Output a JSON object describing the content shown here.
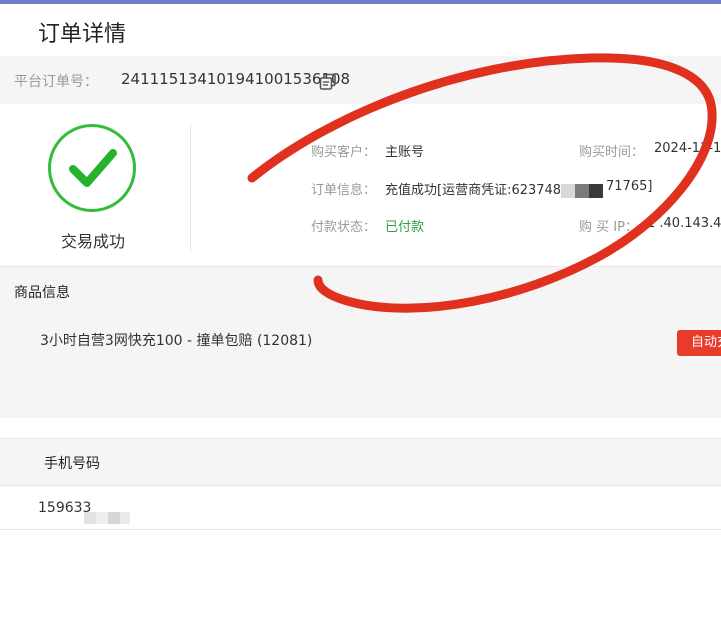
{
  "header": {
    "title": "订单详情"
  },
  "order": {
    "id_label": "平台订单号：",
    "id_value": "241115134101941001536108"
  },
  "status": {
    "text": "交易成功",
    "accent_color": "#33bb3a"
  },
  "details": {
    "customer_label": "购买客户：",
    "customer_value": "主账号",
    "time_label": "购买时间：",
    "time_value": "2024-11-1",
    "order_info_label": "订单信息：",
    "order_info_value_prefix": "充值成功[运营商凭证:623748",
    "order_info_value_suffix": "71765]",
    "payment_label": "付款状态：",
    "payment_value": "已付款",
    "ip_label": "购  买 IP：",
    "ip_value": "1  .40.143.4"
  },
  "goods": {
    "section_title": "商品信息",
    "name": "3小时自营3网快充100 - 撞单包赔 (12081)",
    "badge": "自动充",
    "badge_color": "#e93b2b"
  },
  "phone": {
    "section_title": "手机号码",
    "value": "159633"
  },
  "icons": {
    "copy": "copy-icon",
    "check": "checkmark-icon"
  }
}
